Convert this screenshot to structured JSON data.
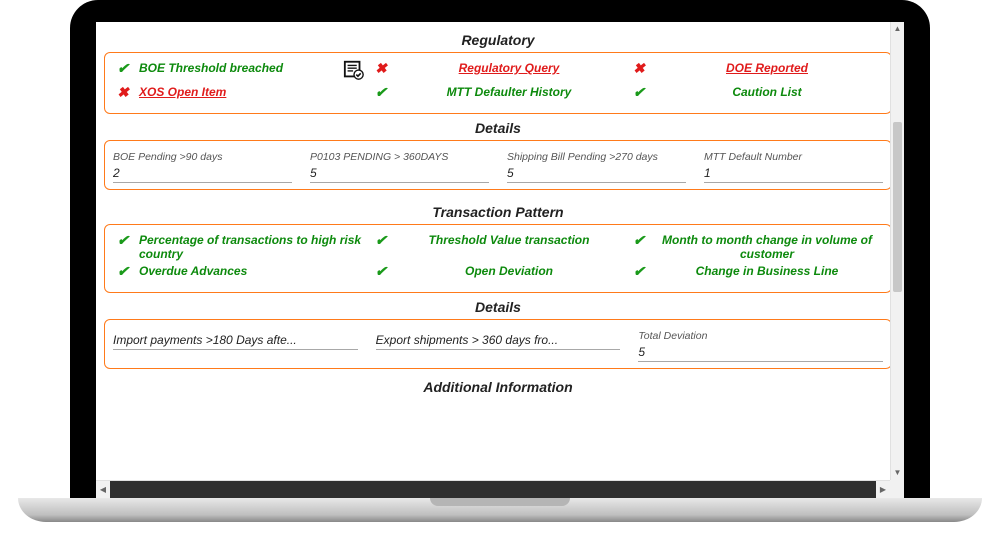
{
  "sections": {
    "regulatory": {
      "title": "Regulatory",
      "row1": [
        {
          "status": "check",
          "label": "BOE Threshold breached",
          "link": false,
          "hasReportIcon": true
        },
        {
          "status": "cross",
          "label": "Regulatory Query",
          "link": true
        },
        {
          "status": "cross",
          "label": "DOE Reported",
          "link": true
        }
      ],
      "row2": [
        {
          "status": "cross",
          "label": "XOS Open Item",
          "link": true
        },
        {
          "status": "check",
          "label": "MTT Defaulter History",
          "link": false
        },
        {
          "status": "check",
          "label": "Caution List",
          "link": false
        }
      ]
    },
    "regulatory_details": {
      "title": "Details",
      "fields": [
        {
          "label": "BOE Pending >90 days",
          "value": "2"
        },
        {
          "label": "P0103 PENDING > 360DAYS",
          "value": "5"
        },
        {
          "label": "Shipping Bill Pending >270 days",
          "value": "5"
        },
        {
          "label": "MTT Default Number",
          "value": "1"
        }
      ]
    },
    "transaction_pattern": {
      "title": "Transaction Pattern",
      "row1": [
        {
          "status": "check",
          "label": "Percentage of transactions to high risk country",
          "link": false
        },
        {
          "status": "check",
          "label": "Threshold Value transaction",
          "link": false
        },
        {
          "status": "check",
          "label": "Month to month change in volume of customer",
          "link": false
        }
      ],
      "row2": [
        {
          "status": "check",
          "label": "Overdue Advances",
          "link": false
        },
        {
          "status": "check",
          "label": "Open Deviation",
          "link": false
        },
        {
          "status": "check",
          "label": "Change in Business Line",
          "link": false
        }
      ]
    },
    "transaction_details": {
      "title": "Details",
      "fields": [
        {
          "label": "",
          "value": "Import payments >180 Days afte..."
        },
        {
          "label": "",
          "value": "Export shipments > 360 days fro..."
        },
        {
          "label": "Total Deviation",
          "value": "5"
        }
      ]
    },
    "additional_info": {
      "title": "Additional Information"
    }
  }
}
